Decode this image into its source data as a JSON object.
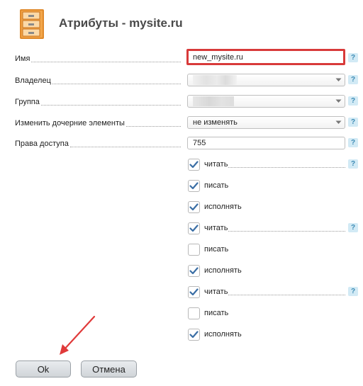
{
  "title": "Атрибуты - mysite.ru",
  "icons": {
    "header": "file-cabinet-icon",
    "help": "question-icon",
    "select_arrow": "chevron-down-icon",
    "check": "checkmark-icon"
  },
  "colors": {
    "highlight": "#d83a3a",
    "check": "#3a6ea5",
    "help_bg": "#d2eaf5"
  },
  "help_label": "?",
  "fields": {
    "name": {
      "label": "Имя",
      "value": "new_mysite.ru"
    },
    "owner": {
      "label": "Владелец"
    },
    "group": {
      "label": "Группа"
    },
    "change_children": {
      "label": "Изменить дочерние элементы",
      "value": "не изменять"
    },
    "permissions": {
      "label": "Права доступа",
      "value": "755"
    }
  },
  "permission_groups": [
    {
      "items": [
        {
          "label": "читать",
          "checked": true
        },
        {
          "label": "писать",
          "checked": true
        },
        {
          "label": "исполнять",
          "checked": true
        }
      ]
    },
    {
      "items": [
        {
          "label": "читать",
          "checked": true
        },
        {
          "label": "писать",
          "checked": false
        },
        {
          "label": "исполнять",
          "checked": true
        }
      ]
    },
    {
      "items": [
        {
          "label": "читать",
          "checked": true
        },
        {
          "label": "писать",
          "checked": false
        },
        {
          "label": "исполнять",
          "checked": true
        }
      ]
    }
  ],
  "buttons": {
    "ok": "Ok",
    "cancel": "Отмена"
  }
}
